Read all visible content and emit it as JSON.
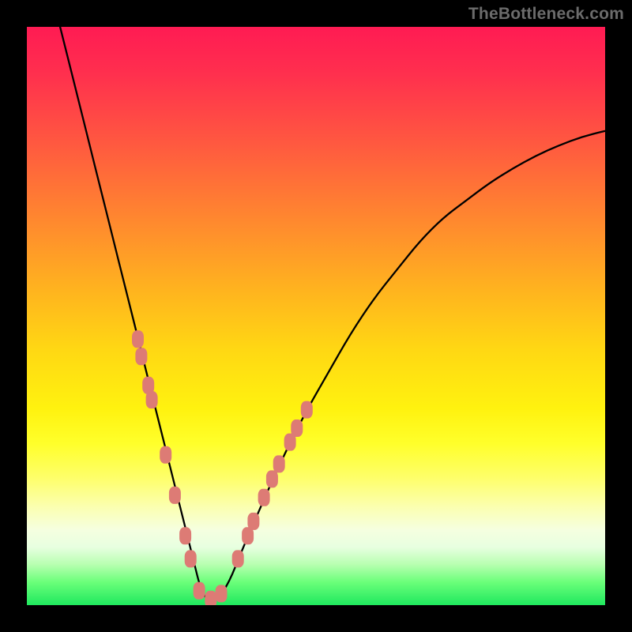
{
  "watermark": "TheBottleneck.com",
  "colors": {
    "marker": "#dd7b75",
    "curve": "#000000",
    "background_frame": "#000000"
  },
  "chart_data": {
    "type": "line",
    "title": "",
    "xlabel": "",
    "ylabel": "",
    "xlim": [
      0,
      100
    ],
    "ylim": [
      0,
      100
    ],
    "legend": false,
    "grid": false,
    "series": [
      {
        "name": "bottleneck-curve",
        "x": [
          5,
          7,
          9,
          11,
          13,
          15,
          17,
          19,
          21,
          23,
          25,
          27,
          29,
          30,
          31,
          33,
          35,
          37,
          40,
          44,
          48,
          52,
          56,
          60,
          64,
          68,
          72,
          76,
          80,
          84,
          88,
          92,
          96,
          100
        ],
        "y": [
          103,
          95,
          87,
          79,
          71,
          63,
          55,
          47,
          39,
          31,
          23,
          15,
          7,
          3,
          1,
          1,
          4,
          9,
          16,
          25,
          33,
          40,
          47,
          53,
          58,
          63,
          67,
          70,
          73,
          75.5,
          77.7,
          79.5,
          81,
          82
        ]
      }
    ],
    "markers": {
      "name": "highlight-points",
      "shape": "rounded-rect",
      "fill": "#dd7b75",
      "points_xy": [
        [
          19.2,
          46.0
        ],
        [
          19.8,
          43.0
        ],
        [
          21.0,
          38.0
        ],
        [
          21.6,
          35.5
        ],
        [
          24.0,
          26.0
        ],
        [
          25.6,
          19.0
        ],
        [
          27.4,
          12.0
        ],
        [
          28.3,
          8.0
        ],
        [
          29.8,
          2.5
        ],
        [
          31.8,
          1.0
        ],
        [
          33.6,
          2.0
        ],
        [
          36.5,
          8.0
        ],
        [
          38.2,
          12.0
        ],
        [
          39.2,
          14.5
        ],
        [
          41.0,
          18.6
        ],
        [
          42.4,
          21.8
        ],
        [
          43.6,
          24.4
        ],
        [
          45.5,
          28.2
        ],
        [
          46.7,
          30.6
        ],
        [
          48.4,
          33.8
        ]
      ]
    }
  }
}
